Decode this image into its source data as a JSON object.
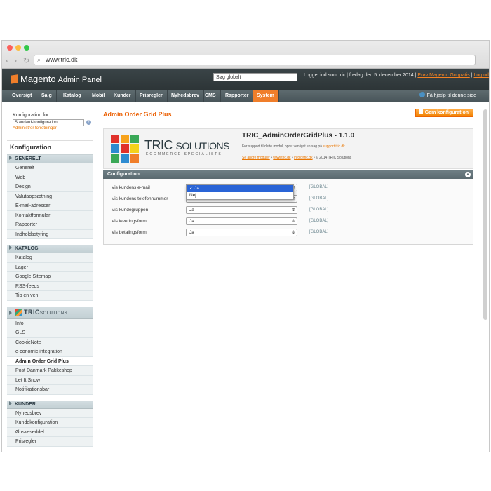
{
  "browser": {
    "url": "www.tric.dk",
    "dots": [
      "#fc605b",
      "#fdbc40",
      "#34c84a"
    ]
  },
  "header": {
    "logo_main": "Magento",
    "logo_sub": "Admin Panel",
    "search_value": "Søg globalt",
    "login_text": "Logget ind som tric  |  fredag den 5. december 2014  |",
    "link_feeds": "Prøv Magento Go gratis",
    "link_logout": "Log ud"
  },
  "nav": {
    "items": [
      "Oversigt",
      "Salg",
      "Katalog",
      "Mobil",
      "Kunder",
      "Prisregler",
      "Nyhedsbrev",
      "CMS",
      "Rapporter",
      "System"
    ],
    "active": "System",
    "help": "Få hjælp til denne side"
  },
  "sidebar": {
    "scope_label": "Konfiguration for:",
    "scope_value": "Standard-konfiguration",
    "scope_link": "Administrer forretninger",
    "title": "Konfiguration",
    "generelt": {
      "label": "GENERELT",
      "items": [
        "Generelt",
        "Web",
        "Design",
        "Valutaopsætning",
        "E-mail-adresser",
        "Kontaktformular",
        "Rapporter",
        "Indholdsstyring"
      ]
    },
    "katalog": {
      "label": "KATALOG",
      "items": [
        "Katalog",
        "Lager",
        "Google Sitemap",
        "RSS-feeds",
        "Tip en ven"
      ]
    },
    "tric": {
      "label": "TRIC",
      "label_small": "SOLUTIONS",
      "items": [
        "Info",
        "GLS",
        "CookieNote",
        "e-conomic integration",
        "Admin Order Grid Plus",
        "Post Danmark Pakkeshop",
        "Let It Snow",
        "Notifikationsbar"
      ],
      "active": "Admin Order Grid Plus"
    },
    "kunder": {
      "label": "KUNDER",
      "items": [
        "Nyhedsbrev",
        "Kundekonfiguration",
        "Ønskeseddel",
        "Prisregler"
      ]
    }
  },
  "main": {
    "title": "Admin Order Grid Plus",
    "save_label": "Gem konfiguration",
    "banner": {
      "brand": "TRIC",
      "brand2": "SOLUTIONS",
      "tagline": "ECOMMERCE SPECIALISTS",
      "ext_name": "TRIC_AdminOrderGridPlus - 1.1.0",
      "support_text": "For support til dette modul, opret venligst en sag på",
      "support_link": "support.tric.dk",
      "link1": "Se andre moduler",
      "link2": "www.tric.dk",
      "link3": "info@tric.dk",
      "copyright": "© 2014 TRIC Solutions"
    },
    "section_title": "Configuration",
    "fields": [
      {
        "label": "Vis kundens e-mail",
        "value": "Ja",
        "scope": "[GLOBAL]"
      },
      {
        "label": "Vis kundens telefonnummer",
        "value": "Ja",
        "scope": "[GLOBAL]"
      },
      {
        "label": "Vis kundegruppen",
        "value": "Ja",
        "scope": "[GLOBAL]"
      },
      {
        "label": "Vis leveringsform",
        "value": "Ja",
        "scope": "[GLOBAL]"
      },
      {
        "label": "Vis betalingsform",
        "value": "Ja",
        "scope": "[GLOBAL]"
      }
    ],
    "dropdown_options": [
      "✓ Ja",
      "Nej"
    ]
  }
}
